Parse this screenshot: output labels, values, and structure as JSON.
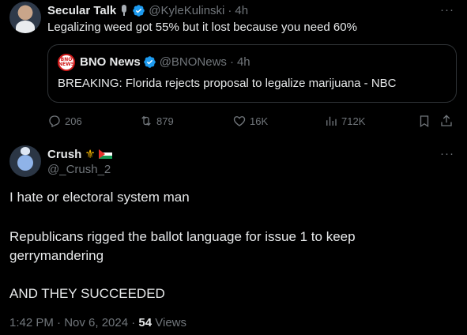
{
  "tweet": {
    "author_name": "Secular Talk",
    "author_handle": "@KyleKulinski",
    "time": "4h",
    "text": "Legalizing weed got 55% but it lost because you need 60%",
    "quote": {
      "author_name": "BNO News",
      "author_handle": "@BNONews",
      "time": "4h",
      "logo_text_top": "BNO",
      "logo_text_bottom": "NEWS",
      "text": "BREAKING: Florida rejects proposal to legalize marijuana - NBC"
    },
    "actions": {
      "replies": "206",
      "retweets": "879",
      "likes": "16K",
      "views": "712K"
    }
  },
  "reply": {
    "author_name": "Crush",
    "author_handle": "@_Crush_2",
    "lines": [
      "I hate or electoral system man",
      "Republicans rigged the ballot language for issue 1 to keep",
      "gerrymandering",
      "AND THEY SUCCEEDED"
    ],
    "timestamp": "1:42 PM · Nov 6, 2024 · ",
    "views_count": "54",
    "views_label": " Views"
  },
  "colors": {
    "background": "#000000",
    "text": "#e7e9ea",
    "muted": "#71767b",
    "verified": "#1d9bf0",
    "border": "#2f3336"
  },
  "icons": [
    "mic-icon",
    "verified-icon",
    "more-icon",
    "reply-icon",
    "retweet-icon",
    "like-icon",
    "views-icon",
    "bookmark-icon",
    "share-icon",
    "trident-icon",
    "palestine-flag-icon"
  ]
}
